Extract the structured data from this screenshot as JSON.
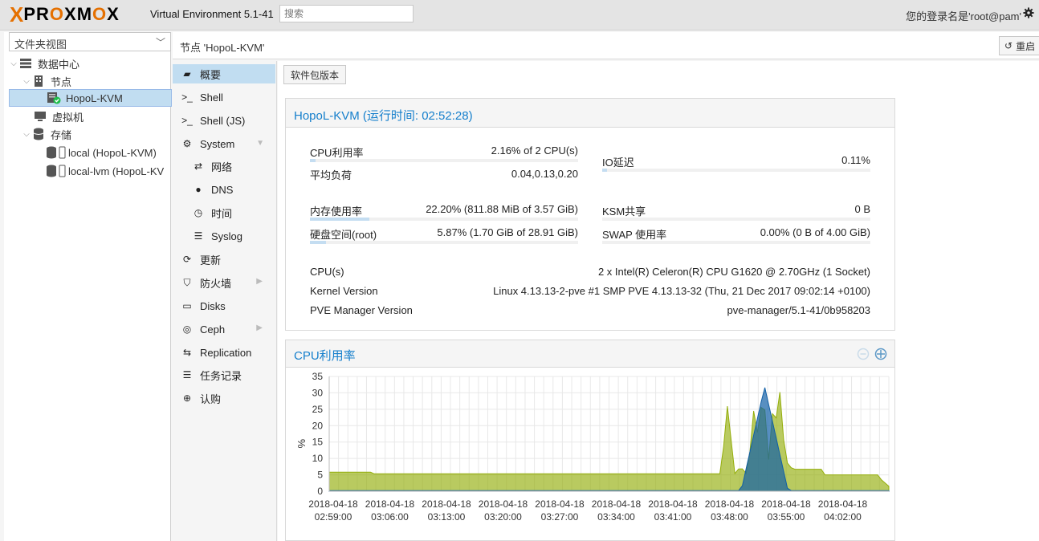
{
  "brand": {
    "logo_x": "X",
    "logo_word_a": "PR",
    "logo_word_o": "O",
    "logo_word_b": "XM",
    "logo_word_o2": "O",
    "logo_word_c": "X",
    "version": "Virtual Environment 5.1-41"
  },
  "search": {
    "placeholder": "搜索"
  },
  "user": {
    "login_text": "您的登录名是'root@pam'"
  },
  "tree": {
    "view_select": "文件夹视图",
    "items": [
      {
        "label": "数据中心"
      },
      {
        "label": "节点"
      },
      {
        "label": "HopoL-KVM"
      },
      {
        "label": "虚拟机"
      },
      {
        "label": "存储"
      },
      {
        "label": "local (HopoL-KVM)"
      },
      {
        "label": "local-lvm (HopoL-KV"
      }
    ]
  },
  "header": {
    "title": "节点 'HopoL-KVM'",
    "reboot_label": "重启"
  },
  "nav": [
    {
      "label": "概要"
    },
    {
      "label": "Shell"
    },
    {
      "label": "Shell (JS)"
    },
    {
      "label": "System"
    },
    {
      "label": "网络"
    },
    {
      "label": "DNS"
    },
    {
      "label": "时间"
    },
    {
      "label": "Syslog"
    },
    {
      "label": "更新"
    },
    {
      "label": "防火墙"
    },
    {
      "label": "Disks"
    },
    {
      "label": "Ceph"
    },
    {
      "label": "Replication"
    },
    {
      "label": "任务记录"
    },
    {
      "label": "认购"
    }
  ],
  "toolbar": {
    "pkg_versions": "软件包版本"
  },
  "status": {
    "title": "HopoL-KVM (运行时间: 02:52:28)",
    "cpu_label": "CPU利用率",
    "cpu_value": "2.16% of 2 CPU(s)",
    "cpu_fraction": 0.0216,
    "load_label": "平均负荷",
    "load_value": "0.04,0.13,0.20",
    "io_label": "IO延迟",
    "io_value": "0.11%",
    "io_fraction": 0.0011,
    "mem_label": "内存使用率",
    "mem_value": "22.20% (811.88 MiB of 3.57 GiB)",
    "mem_fraction": 0.222,
    "ksm_label": "KSM共享",
    "ksm_value": "0 B",
    "disk_label": "硬盘空间(root)",
    "disk_value": "5.87% (1.70 GiB of 28.91 GiB)",
    "disk_fraction": 0.0587,
    "swap_label": "SWAP 使用率",
    "swap_value": "0.00% (0 B of 4.00 GiB)",
    "swap_fraction": 0,
    "cpus_label": "CPU(s)",
    "cpus_value": "2 x Intel(R) Celeron(R) CPU G1620 @ 2.70GHz (1 Socket)",
    "kernel_label": "Kernel Version",
    "kernel_value": "Linux 4.13.13-2-pve #1 SMP PVE 4.13.13-32 (Thu, 21 Dec 2017 09:02:14 +0100)",
    "pve_label": "PVE Manager Version",
    "pve_value": "pve-manager/5.1-41/0b958203"
  },
  "cpu_panel": {
    "title": "CPU利用率"
  },
  "colors": {
    "accent": "#157fcc",
    "series_cpu": "#94ae0a",
    "series_io": "#115fa6"
  },
  "chart_data": {
    "type": "area",
    "title": "CPU利用率",
    "ylabel": "%",
    "ylim": [
      0,
      35
    ],
    "yticks": [
      0,
      5,
      10,
      15,
      20,
      25,
      30,
      35
    ],
    "xtick_labels": [
      [
        "2018-04-18",
        "02:59:00"
      ],
      [
        "2018-04-18",
        "03:06:00"
      ],
      [
        "2018-04-18",
        "03:13:00"
      ],
      [
        "2018-04-18",
        "03:20:00"
      ],
      [
        "2018-04-18",
        "03:27:00"
      ],
      [
        "2018-04-18",
        "03:34:00"
      ],
      [
        "2018-04-18",
        "03:41:00"
      ],
      [
        "2018-04-18",
        "03:48:00"
      ],
      [
        "2018-04-18",
        "03:55:00"
      ],
      [
        "2018-04-18",
        "04:02:00"
      ]
    ],
    "series": [
      {
        "values": [
          5.8,
          5.8,
          5.8,
          5.8,
          5.8,
          5.7,
          5.7,
          5.7,
          5.2,
          5.2,
          5.2,
          5.3,
          5.3,
          5.3,
          5.2,
          5.2,
          5.4,
          5.3,
          5.2,
          5.4,
          5.3,
          5.3,
          5.3,
          5.2,
          5.2,
          5.2,
          5.2,
          5.3,
          5.2,
          5.2,
          5.3,
          5.4,
          5.2,
          5.3,
          5.5,
          5.2,
          5.2,
          5.2,
          5.2,
          5.3,
          5.2,
          5.3,
          5.2,
          5.2,
          5.2,
          5.3,
          5.2,
          5.3,
          5.0,
          5.5,
          5.3,
          5.3,
          5.3,
          5.2,
          5.2,
          5.2,
          5.2,
          5.3,
          5.5,
          5.2,
          5.3,
          5.2,
          5.2,
          5.2,
          5.5,
          5.2,
          5.2,
          5.2,
          5.2,
          5.5,
          5.2,
          5.1,
          5.2,
          5.2,
          5.3,
          5.0,
          5.2,
          5.2,
          5.2,
          5.2,
          5.2,
          5.2,
          5.2,
          5.3,
          5.3,
          5.3,
          5.0,
          5.5,
          5.4,
          5.3,
          5.3,
          5.3,
          5.3,
          5.0,
          5.0,
          5.0,
          5.0,
          5.0,
          5.4,
          5.2,
          5.3,
          5.3,
          5.2,
          5.2,
          5.2,
          5.3,
          5.3,
          5.3,
          5.2,
          5.2,
          5.4,
          5.5,
          5.3,
          5.3,
          5.3,
          5.3,
          5.3,
          5.2,
          5.2,
          5.0,
          5.5,
          5.3,
          5.3,
          5.3,
          5.0,
          5.0,
          5.0,
          5.0,
          5.0,
          5.1,
          5.2,
          5.2,
          5.2,
          5.0,
          5.0,
          5.3,
          5.3,
          5.2,
          5.3,
          5.0,
          5.2,
          5.3,
          5.5,
          5.3,
          4.9,
          5.2,
          5.3,
          5.3,
          5.3,
          5.3,
          5.3,
          5.2,
          5.2,
          5.0,
          5.5,
          5.3,
          5.3,
          5.4,
          5.2,
          5.2,
          5.2,
          5.2,
          5.2,
          5.1,
          5.0,
          5.5,
          5.0,
          5.0,
          5.0,
          5.0,
          5.2,
          5.3,
          5.3,
          5.3,
          5.0,
          5.0,
          5.0,
          5.0,
          5.0,
          5.2,
          5.4,
          5.3,
          5.3,
          5.3,
          5.2,
          5.0,
          5.0,
          5.3,
          5.2,
          5.3,
          5.3,
          5.3,
          5.0,
          5.0,
          5.3,
          5.2,
          5.2,
          5.3,
          5.3,
          5.0,
          5.2,
          5.3,
          5.5,
          5.3,
          5.0,
          5.3,
          5.0,
          5.0,
          5.0,
          5.0,
          5.2,
          5.2,
          5.3,
          5.3,
          5.3,
          5.0,
          5.0,
          5.1,
          5.3,
          5.0,
          5.0,
          5.2,
          5.3,
          5.3,
          5.4,
          5.0,
          5.0,
          5.3,
          5.0,
          5.2,
          5.3,
          5.0,
          5.0,
          5.0,
          5.3,
          5.3,
          5.3,
          5.3,
          5.3,
          5.1,
          5.2,
          5.0,
          5.0,
          5.3,
          5.3,
          5.0,
          5.3,
          5.0,
          5.2,
          5.3,
          5.3,
          5.3,
          5.3,
          5.3,
          5.0,
          5.2,
          5.3,
          5.0,
          5.3,
          5.3,
          5.3,
          5.3,
          5.5,
          5.5,
          5.3,
          5.5,
          5.0,
          5.2,
          5.0,
          5.3,
          5.0,
          5.3,
          5.3,
          5.2,
          5.0,
          5.0,
          5.0,
          5.0,
          5.2,
          5.3,
          5.3,
          5.0,
          5.0,
          5.0,
          5.5,
          5.5,
          5.2,
          5.3,
          5.0,
          5.3,
          5.3,
          5.3,
          5.0,
          5.0,
          5.2,
          5.2,
          5.2,
          5.5,
          5.5,
          5.5,
          5.3,
          5.3,
          5.3,
          5.5,
          5.5,
          5.5,
          5.5,
          5.2,
          5.2,
          5.3,
          5.5,
          5.5,
          5.3,
          5.5,
          5.5,
          5.5,
          5.2,
          5.2,
          5.3,
          5.3,
          5.5,
          5.3,
          5.5,
          5.3,
          5.5,
          5.5,
          5.5,
          5.5,
          5.2,
          5.0,
          5.3,
          5.3,
          5.3,
          5.3,
          5.3,
          5.3,
          5.3,
          5.3,
          5.3,
          5.5,
          5.5,
          5.3,
          5.3,
          5.3,
          5.3,
          5.3,
          5.3,
          5.3,
          5.3,
          5.3,
          5.5,
          5.3,
          5.3,
          5.3,
          5.3,
          5.3,
          5.3,
          5.3,
          5.3,
          5.3,
          5.3,
          5.3,
          5.5,
          5.5,
          5.5,
          5.5,
          5.5,
          5.2,
          5.0,
          5.3,
          5.3,
          5.5,
          5.5,
          5.5,
          5.5,
          5.5,
          5.5,
          5.5,
          5.5,
          5.3,
          5.5,
          5.5,
          5.5,
          5.5,
          5.5,
          5.5,
          5.5,
          5.3,
          5.3,
          5.3,
          5.3,
          5.3,
          5.3,
          5.3,
          5.3,
          5.3,
          5.5,
          5.5,
          5.5,
          5.5,
          5.5,
          5.5,
          5.5,
          5.5,
          5.5,
          5.5,
          5.3,
          5.3,
          5.3,
          5.3,
          5.3,
          5.3,
          5.3,
          5.3,
          5.3,
          5.3,
          5.3,
          5.3,
          5.3,
          5.3,
          5.3,
          5.3,
          5.3,
          5.3,
          5.3,
          5.3,
          5.3,
          5.3,
          5.3,
          5.3,
          5.3,
          5.3,
          5.3,
          5.3,
          5.3,
          5.3,
          5.3,
          5.3,
          5.3,
          5.3,
          5.3,
          5.3,
          5.3,
          5.3,
          5.3,
          5.3,
          5.3,
          5.3,
          5.3,
          5.3,
          5.3,
          5.3,
          5.3,
          5.3,
          5.3,
          5.3,
          5.3,
          5.3,
          5.3,
          5.3,
          5.3,
          5.3,
          5.3,
          5.3,
          5.3,
          5.3,
          5.3,
          5.3,
          5.3,
          5.3,
          5.3,
          5.3,
          5.3,
          5.3,
          5.3
        ]
      },
      {
        "values": []
      }
    ]
  }
}
